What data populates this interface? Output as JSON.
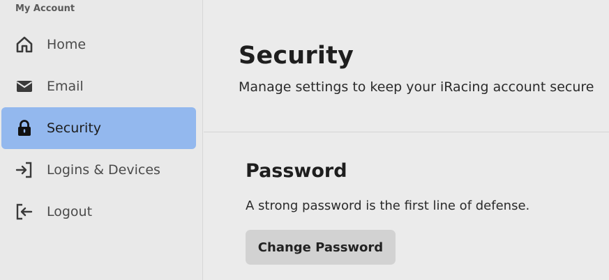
{
  "sidebar": {
    "section_label": "My Account",
    "items": [
      {
        "label": "Home",
        "icon": "home-icon",
        "active": false
      },
      {
        "label": "Email",
        "icon": "envelope-icon",
        "active": false
      },
      {
        "label": "Security",
        "icon": "lock-icon",
        "active": true
      },
      {
        "label": "Logins & Devices",
        "icon": "login-icon",
        "active": false
      },
      {
        "label": "Logout",
        "icon": "logout-icon",
        "active": false
      }
    ],
    "active_color": "#93b8ee"
  },
  "main": {
    "title": "Security",
    "subtitle": "Manage settings to keep your iRacing account secure",
    "password_section": {
      "title": "Password",
      "description": "A strong password is the first line of defense.",
      "button_label": "Change Password"
    }
  }
}
